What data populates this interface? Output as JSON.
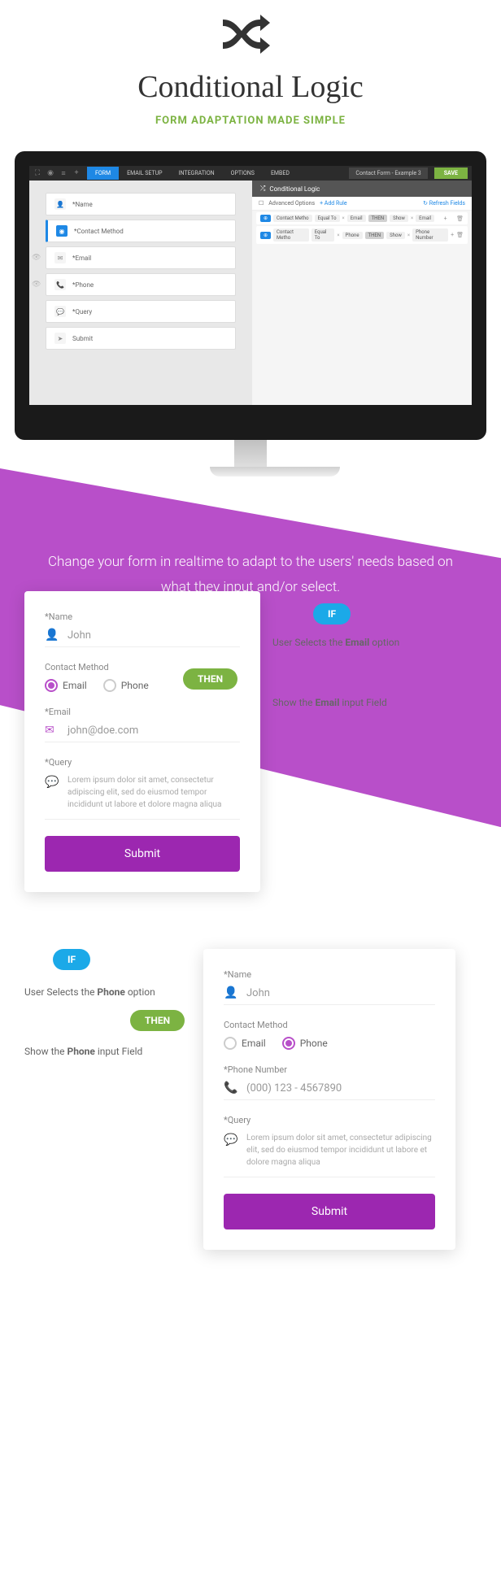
{
  "hero": {
    "title": "Conditional Logic",
    "subtitle": "FORM ADAPTATION MADE SIMPLE"
  },
  "monitor": {
    "tabs": [
      "FORM",
      "EMAIL SETUP",
      "INTEGRATION",
      "OPTIONS",
      "EMBED"
    ],
    "breadcrumb": "Contact Form - Example 3",
    "save": "SAVE",
    "fields": [
      {
        "icon": "👤",
        "label": "*Name"
      },
      {
        "icon": "◉",
        "label": "*Contact Method",
        "active": true
      },
      {
        "icon": "✉",
        "label": "*Email",
        "eye": true
      },
      {
        "icon": "📞",
        "label": "*Phone",
        "eye": true
      },
      {
        "icon": "💬",
        "label": "*Query"
      },
      {
        "icon": "➤",
        "label": "Submit"
      }
    ],
    "panel": {
      "title": "Conditional Logic",
      "advanced": "Advanced Options",
      "add_rule": "+ Add Rule",
      "refresh": "↻ Refresh Fields",
      "rules": [
        {
          "field": "Contact Metho",
          "op": "Equal To",
          "val": "Email",
          "then": "THEN",
          "action": "Show",
          "target": "Email"
        },
        {
          "field": "Contact Metho",
          "op": "Equal To",
          "val": "Phone",
          "then": "THEN",
          "action": "Show",
          "target": "Phone Number"
        }
      ]
    }
  },
  "purple_text": "Change your form in realtime to adapt to the users' needs based on what they input and/or select.",
  "badges": {
    "if": "IF",
    "then": "THEN"
  },
  "ex1": {
    "cond_pre": "User Selects the ",
    "cond_b": "Email",
    "cond_post": " option",
    "res_pre": "Show the ",
    "res_b": "Email",
    "res_post": " input Field",
    "name_label": "*Name",
    "name_val": "John",
    "cm_label": "Contact Method",
    "email": "Email",
    "phone": "Phone",
    "email_label": "*Email",
    "email_val": "john@doe.com",
    "query_label": "*Query",
    "query_text": "Lorem ipsum dolor sit amet, consectetur adipiscing elit, sed do eiusmod tempor incididunt ut labore et dolore magna aliqua",
    "submit": "Submit"
  },
  "ex2": {
    "cond_pre": "User Selects the ",
    "cond_b": "Phone",
    "cond_post": " option",
    "res_pre": "Show the ",
    "res_b": "Phone",
    "res_post": " input Field",
    "name_label": "*Name",
    "name_val": "John",
    "cm_label": "Contact Method",
    "email": "Email",
    "phone": "Phone",
    "phone_label": "*Phone Number",
    "phone_val": "(000) 123 - 4567890",
    "query_label": "*Query",
    "query_text": "Lorem ipsum dolor sit amet, consectetur adipiscing elit, sed do eiusmod tempor incididunt ut labore et dolore magna aliqua",
    "submit": "Submit"
  }
}
